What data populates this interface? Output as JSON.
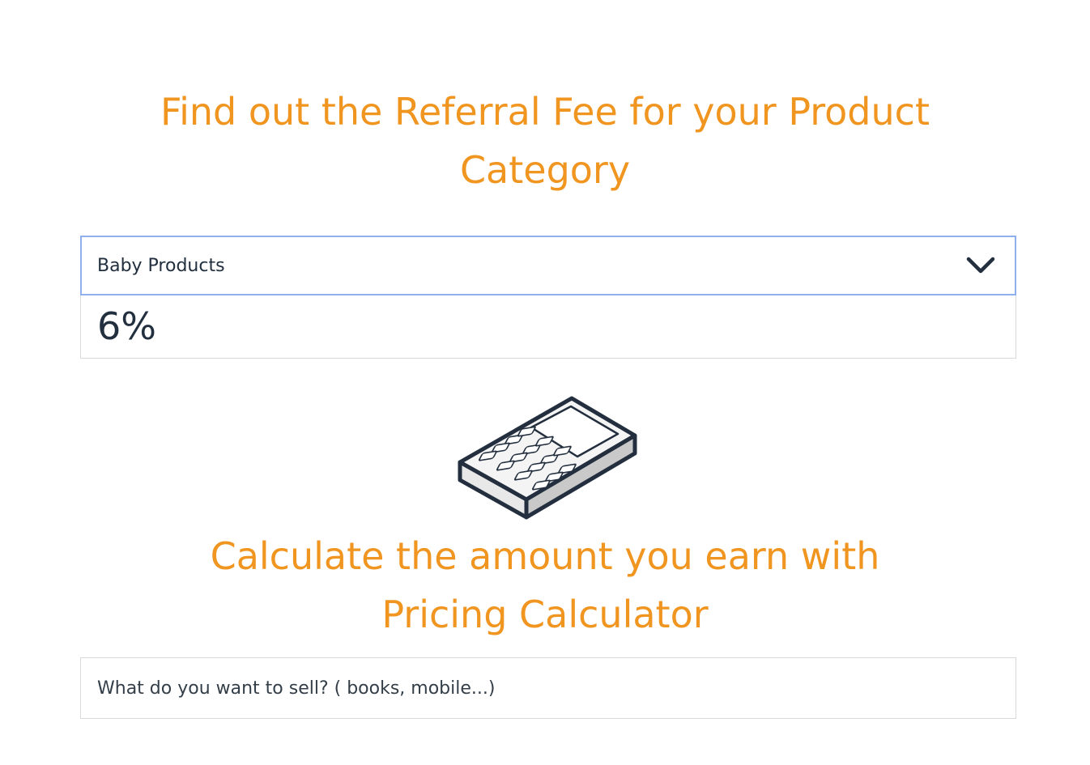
{
  "referral": {
    "heading_line1": "Find out the Referral Fee for your Product",
    "heading_line2": "Category",
    "selected_category": "Baby Products",
    "fee": "6%"
  },
  "calculator": {
    "icon": "calculator-icon",
    "heading_line1": "Calculate the amount you earn with",
    "heading_line2": "Pricing Calculator",
    "search_placeholder": "What do you want to sell? ( books, mobile...)"
  },
  "colors": {
    "accent": "#f0951f",
    "select_border": "#8fb0ec",
    "text": "#222f3e"
  }
}
